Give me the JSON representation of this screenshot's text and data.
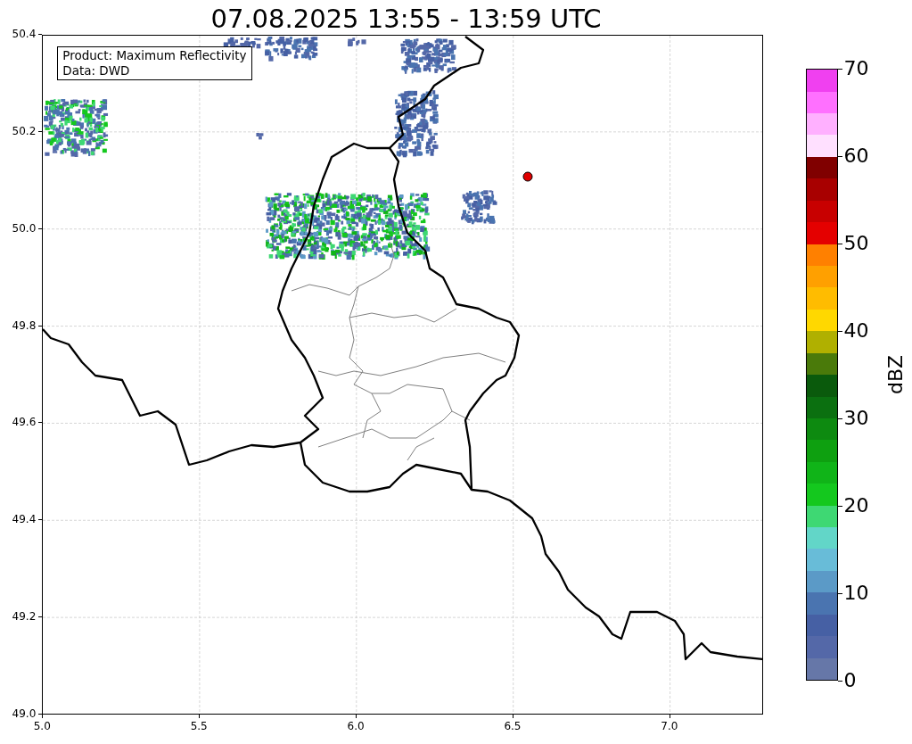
{
  "title": "07.08.2025 13:55 - 13:59 UTC",
  "info_box": [
    "Product: Maximum Reflectivity",
    "Data: DWD"
  ],
  "x_ticks": [
    "5.0",
    "5.5",
    "6.0",
    "6.5",
    "7.0"
  ],
  "y_ticks": [
    "50.4",
    "50.2",
    "50.0",
    "49.8",
    "49.6",
    "49.4",
    "49.2",
    "49.0"
  ],
  "colorbar": {
    "label": "dBZ",
    "ticks": [
      "70",
      "60",
      "50",
      "40",
      "30",
      "20",
      "10",
      "0"
    ],
    "segments": [
      {
        "color": "#6677a8"
      },
      {
        "color": "#5468a8"
      },
      {
        "color": "#4660a4"
      },
      {
        "color": "#4a74b0"
      },
      {
        "color": "#5b9ac7"
      },
      {
        "color": "#68bcd8"
      },
      {
        "color": "#62d6c8"
      },
      {
        "color": "#3ed873"
      },
      {
        "color": "#14c81e"
      },
      {
        "color": "#10b418"
      },
      {
        "color": "#0ea010"
      },
      {
        "color": "#0d8a10"
      },
      {
        "color": "#0b7010"
      },
      {
        "color": "#0a5a0c"
      },
      {
        "color": "#4a7a0a"
      },
      {
        "color": "#b0b000"
      },
      {
        "color": "#ffd800"
      },
      {
        "color": "#ffbc00"
      },
      {
        "color": "#ffa000"
      },
      {
        "color": "#ff8000"
      },
      {
        "color": "#e40000"
      },
      {
        "color": "#c80000"
      },
      {
        "color": "#a80000"
      },
      {
        "color": "#800000"
      },
      {
        "color": "#ffe0ff"
      },
      {
        "color": "#ffb0ff"
      },
      {
        "color": "#ff70ff"
      },
      {
        "color": "#f040f0"
      }
    ]
  }
}
